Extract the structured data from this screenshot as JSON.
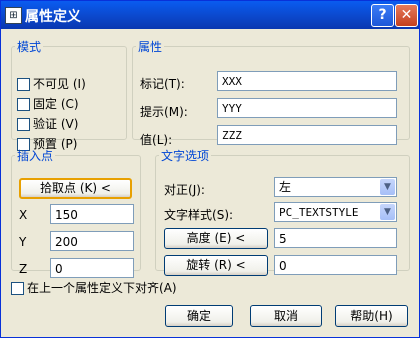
{
  "window": {
    "title": "属性定义",
    "icon": "cad-icon",
    "help_glyph": "?",
    "close_glyph": "✕"
  },
  "mode": {
    "legend": "模式",
    "options": [
      {
        "label": "不可见",
        "key": "I",
        "checked": false
      },
      {
        "label": "固定",
        "key": "C",
        "checked": false
      },
      {
        "label": "验证",
        "key": "V",
        "checked": false
      },
      {
        "label": "预置",
        "key": "P",
        "checked": false
      }
    ]
  },
  "attribute": {
    "legend": "属性",
    "tag_label": "标记",
    "tag_key": "T",
    "tag_value": "XXX",
    "prompt_label": "提示",
    "prompt_key": "M",
    "prompt_value": "YYY",
    "value_label": "值",
    "value_key": "L",
    "value_value": "ZZZ"
  },
  "insertion": {
    "legend": "插入点",
    "pick_label": "拾取点",
    "pick_key": "K",
    "pick_glyph": "<",
    "x_label": "X",
    "x_value": "150",
    "y_label": "Y",
    "y_value": "200",
    "z_label": "Z",
    "z_value": "0"
  },
  "text_options": {
    "legend": "文字选项",
    "justify_label": "对正",
    "justify_key": "J",
    "justify_value": "左",
    "style_label": "文字样式",
    "style_key": "S",
    "style_value": "PC_TEXTSTYLE",
    "height_label": "高度",
    "height_key": "E",
    "height_glyph": "<",
    "height_value": "5",
    "rotation_label": "旋转",
    "rotation_key": "R",
    "rotation_glyph": "<",
    "rotation_value": "0"
  },
  "align_below": {
    "label": "在上一个属性定义下对齐",
    "key": "A",
    "checked": false
  },
  "buttons": {
    "ok": "确定",
    "cancel": "取消",
    "help": "帮助",
    "help_key": "H"
  }
}
